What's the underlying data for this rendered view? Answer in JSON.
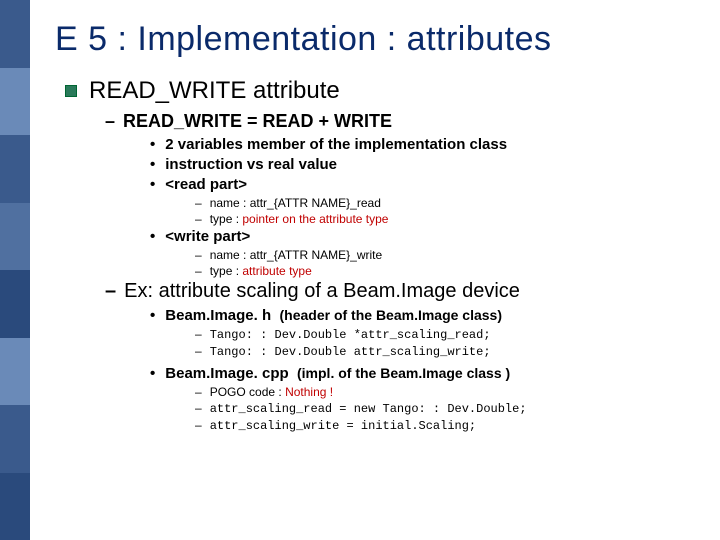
{
  "sidebar_colors": [
    "#3a5a8c",
    "#6a8ab8",
    "#3a5a8c",
    "#5070a0",
    "#2a4a7c",
    "#6a8ab8",
    "#3a5a8c",
    "#2a4a7c"
  ],
  "title": "E 5 : Implementation : attributes",
  "h1": "READ_WRITE attribute",
  "rw_eq": "READ_WRITE = READ + WRITE",
  "b1": "2 variables member of the implementation class",
  "b2": "instruction vs real value",
  "b3": "<read part>",
  "rp_name_label": "name : attr_{ATTR NAME}_read",
  "rp_type_label": "type : ",
  "rp_type_val": "pointer on the attribute type",
  "b4": "<write part>",
  "wp_name_label": "name : attr_{ATTR NAME}_write",
  "wp_type_label": "type : ",
  "wp_type_val": "attribute type",
  "ex_label": "Ex: attribute scaling of a Beam.Image device",
  "h_file": "Beam.Image. h",
  "h_desc": "(header of the Beam.Image class)",
  "h_line1": "Tango: : Dev.Double *attr_scaling_read;",
  "h_line2": "Tango: : Dev.Double attr_scaling_write;",
  "c_file": "Beam.Image. cpp",
  "c_desc": "(impl. of the Beam.Image class )",
  "c_line0_label": "POGO code : ",
  "c_line0_val": "Nothing !",
  "c_line1": "attr_scaling_read  = new Tango: : Dev.Double;",
  "c_line2": "attr_scaling_write = initial.Scaling;"
}
